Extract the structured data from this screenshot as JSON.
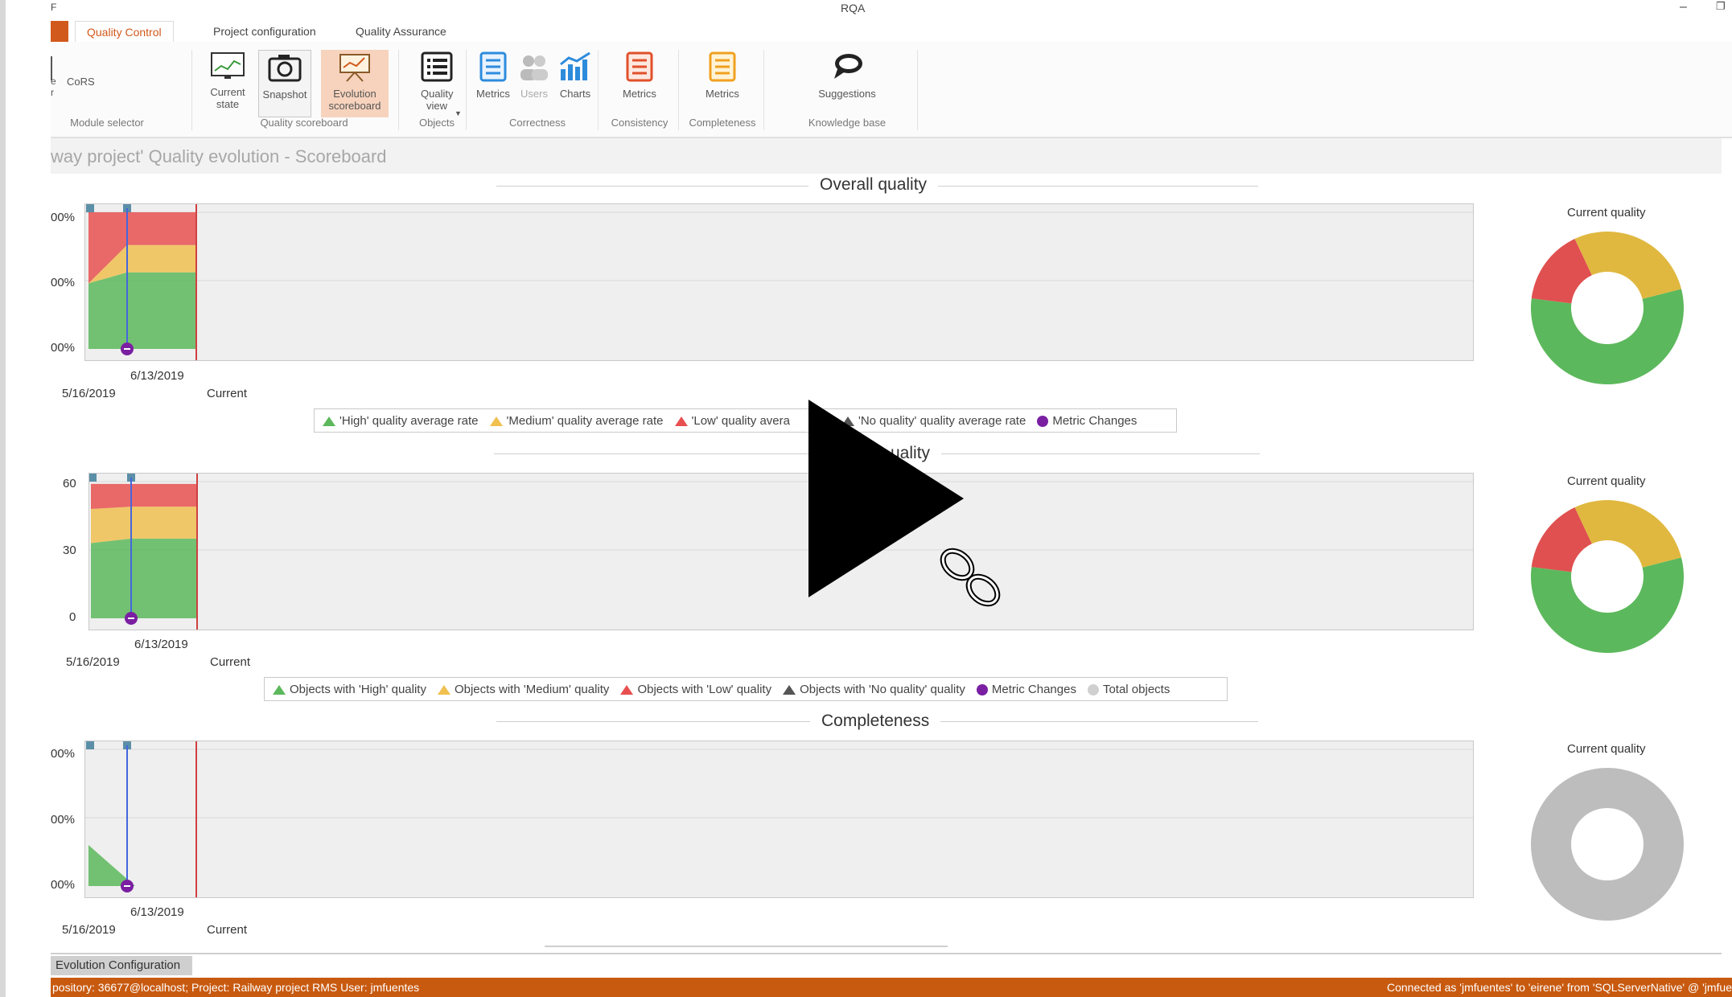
{
  "window": {
    "title": "RQA"
  },
  "tabs": [
    {
      "label": "Quality Control",
      "active": true
    },
    {
      "label": "Project configuration",
      "active": false
    },
    {
      "label": "Quality Assurance",
      "active": false
    }
  ],
  "ribbon": {
    "module_label": "CoRS",
    "module_group": "Module selector",
    "buttons": {
      "current_state": "Current state",
      "snapshot": "Snapshot",
      "evolution_scoreboard": "Evolution scoreboard",
      "quality_view": "Quality view",
      "metrics_correctness": "Metrics",
      "users": "Users",
      "charts": "Charts",
      "metrics_consistency": "Metrics",
      "metrics_completeness": "Metrics",
      "suggestions": "Suggestions"
    },
    "groups": {
      "quality_scoreboard": "Quality scoreboard",
      "objects": "Objects",
      "correctness": "Correctness",
      "consistency": "Consistency",
      "completeness": "Completeness",
      "knowledge_base": "Knowledge base"
    }
  },
  "page_title": "way project' Quality evolution - Scoreboard",
  "current_quality_label": "Current quality",
  "sections": {
    "overall": "Overall quality",
    "objects_partial": "uality",
    "completeness": "Completeness"
  },
  "legends": {
    "overall": [
      "'High' quality average rate",
      "'Medium' quality average rate",
      "'Low' quality avera",
      "'No quality' quality average rate",
      "Metric Changes"
    ],
    "objects": [
      "Objects with 'High' quality",
      "Objects with 'Medium' quality",
      "Objects with 'Low' quality",
      "Objects with 'No quality' quality",
      "Metric Changes",
      "Total objects"
    ]
  },
  "colors": {
    "high": "#5cb85c",
    "medium": "#f0c050",
    "low": "#e85050",
    "none": "#555555",
    "metric": "#7a1fa2",
    "total": "#d0d0d0",
    "accent": "#d2591c"
  },
  "bottom_tab": "Evolution Configuration",
  "status": {
    "left": "pository: 36677@localhost; Project: Railway project    RMS User: jmfuentes",
    "right": "Connected as 'jmfuentes' to 'eirene' from 'SQLServerNative' @ 'jmfue"
  },
  "chart_data": [
    {
      "type": "area",
      "title": "Overall quality",
      "yticks": [
        "00%",
        "00%",
        "00%"
      ],
      "x": [
        "5/16/2019",
        "6/13/2019",
        "Current"
      ],
      "series": [
        {
          "name": "'High' quality average rate",
          "values": [
            48,
            56
          ]
        },
        {
          "name": "'Medium' quality average rate",
          "values": [
            0,
            20
          ]
        },
        {
          "name": "'Low' quality avera",
          "values": [
            52,
            24
          ]
        }
      ],
      "donut": [
        {
          "name": "'High' quality average rate",
          "value": 56
        },
        {
          "name": "'Low' quality avera",
          "value": 16
        },
        {
          "name": "'Medium' quality average rate",
          "value": 28
        }
      ]
    },
    {
      "type": "area",
      "title": "uality",
      "yticks": [
        "60",
        "30",
        "0"
      ],
      "ylim": [
        0,
        60
      ],
      "x": [
        "5/16/2019",
        "6/13/2019",
        "Current"
      ],
      "series": [
        {
          "name": "Objects with 'High' quality",
          "values": [
            33,
            35
          ]
        },
        {
          "name": "Objects with 'Medium' quality",
          "values": [
            15,
            14
          ]
        },
        {
          "name": "Objects with 'Low' quality",
          "values": [
            11,
            10
          ]
        }
      ],
      "donut": [
        {
          "name": "Objects with 'High' quality",
          "value": 56
        },
        {
          "name": "Objects with 'Low' quality",
          "value": 16
        },
        {
          "name": "Objects with 'Medium' quality",
          "value": 28
        }
      ]
    },
    {
      "type": "area",
      "title": "Completeness",
      "yticks": [
        "00%",
        "00%",
        "00%"
      ],
      "x": [
        "5/16/2019",
        "6/13/2019",
        "Current"
      ],
      "series": [
        {
          "name": "High",
          "values": [
            30,
            0
          ]
        }
      ],
      "donut": [
        {
          "name": "No quality",
          "value": 100
        }
      ]
    }
  ]
}
